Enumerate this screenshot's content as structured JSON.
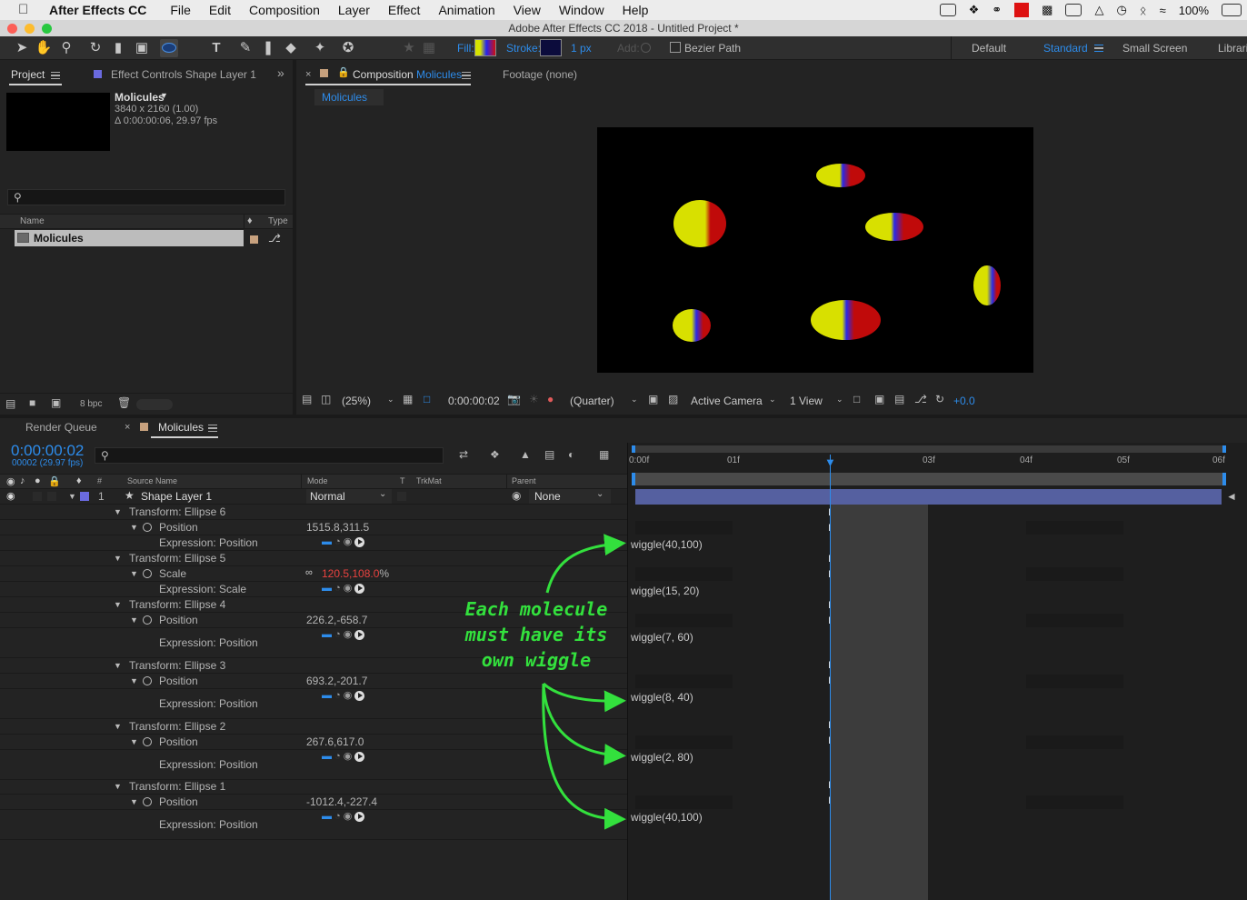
{
  "menubar": {
    "app_name": "After Effects CC",
    "items": [
      "File",
      "Edit",
      "Composition",
      "Layer",
      "Effect",
      "Animation",
      "View",
      "Window",
      "Help"
    ],
    "battery": "100%"
  },
  "window": {
    "title": "Adobe After Effects CC 2018 - Untitled Project *"
  },
  "toolbar": {
    "fill_label": "Fill:",
    "stroke_label": "Stroke:",
    "stroke_width": "1 px",
    "add_label": "Add:",
    "bezier_label": "Bezier Path",
    "workspaces": [
      "Default",
      "Standard",
      "Small Screen",
      "Librari"
    ],
    "active_workspace": "Standard"
  },
  "project_panel": {
    "tab_project": "Project",
    "tab_effect": "Effect Controls Shape Layer 1",
    "comp_name": "Molicules",
    "comp_res": "3840 x 2160 (1.00)",
    "comp_dur": "Δ 0:00:00:06, 29.97 fps",
    "col_name": "Name",
    "col_type": "Type",
    "item_name": "Molicules",
    "bpc": "8 bpc"
  },
  "comp_panel": {
    "tab_prefix": "Composition",
    "tab_comp": "Molicules",
    "tab_footage": "Footage (none)",
    "subtab": "Molicules",
    "zoom": "(25%)",
    "timecode": "0:00:00:02",
    "resolution": "(Quarter)",
    "camera": "Active Camera",
    "views": "1 View",
    "exposure": "+0.0"
  },
  "timeline": {
    "tab_render": "Render Queue",
    "tab_comp": "Molicules",
    "timecode": "0:00:00:02",
    "frame_info": "00002 (29.97 fps)",
    "col_num": "#",
    "col_source": "Source Name",
    "col_mode": "Mode",
    "col_t": "T",
    "col_trkmat": "TrkMat",
    "col_parent": "Parent",
    "ruler": [
      "0:00f",
      "01f",
      "03f",
      "04f",
      "05f",
      "06f"
    ],
    "layer": {
      "num": "1",
      "name": "Shape Layer 1",
      "mode": "Normal",
      "parent": "None"
    },
    "groups": [
      {
        "name": "Transform: Ellipse 6",
        "prop": "Position",
        "v1": "1515.8",
        "v2": "311.5",
        "expr_label": "Expression: Position",
        "expr": "wiggle(40,100)"
      },
      {
        "name": "Transform: Ellipse 5",
        "prop": "Scale",
        "v1": "120.5",
        "v2": "108.0",
        "unit": "%",
        "expr_label": "Expression: Scale",
        "expr": "wiggle(15, 20)"
      },
      {
        "name": "Transform: Ellipse 4",
        "prop": "Position",
        "v1": "226.2",
        "v2": "-658.7",
        "expr_label": "Expression: Position",
        "expr": "wiggle(7, 60)"
      },
      {
        "name": "Transform: Ellipse 3",
        "prop": "Position",
        "v1": "693.2",
        "v2": "-201.7",
        "expr_label": "Expression: Position",
        "expr": "wiggle(8, 40)"
      },
      {
        "name": "Transform: Ellipse 2",
        "prop": "Position",
        "v1": "267.6",
        "v2": "617.0",
        "expr_label": "Expression: Position",
        "expr": "wiggle(2, 80)"
      },
      {
        "name": "Transform: Ellipse 1",
        "prop": "Position",
        "v1": "-1012.4",
        "v2": "-227.4",
        "expr_label": "Expression: Position",
        "expr": "wiggle(40,100)"
      }
    ]
  },
  "annotation": {
    "line1": "Each molecule",
    "line2": "must have its",
    "line3": "own wiggle",
    "color": "#33e03d"
  }
}
